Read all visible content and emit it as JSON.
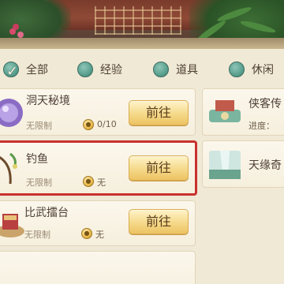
{
  "tabs": [
    {
      "label": "全部",
      "selected": true
    },
    {
      "label": "经验",
      "selected": false
    },
    {
      "label": "道具",
      "selected": false
    },
    {
      "label": "休闲",
      "selected": false
    }
  ],
  "activities": [
    {
      "title": "洞天秘境",
      "limit": "无限制",
      "count": "0/10",
      "button": "前往",
      "icon": "crystal-orb-icon",
      "selected": false
    },
    {
      "title": "钓鱼",
      "limit": "无限制",
      "count": "无",
      "button": "前往",
      "icon": "fishing-rod-icon",
      "selected": true
    },
    {
      "title": "比武擂台",
      "limit": "无限制",
      "count": "无",
      "button": "前往",
      "icon": "arena-stage-icon",
      "selected": false
    }
  ],
  "side_activities": [
    {
      "title": "侠客传",
      "progress_label": "进度：",
      "icon": "scroll-pavilion-icon"
    },
    {
      "title": "天缘奇",
      "icon": "waterfall-icon"
    }
  ],
  "colors": {
    "selected_border": "#c9302f",
    "tab_dot": "#5aa08e",
    "button_gold": "#f5d98a"
  }
}
